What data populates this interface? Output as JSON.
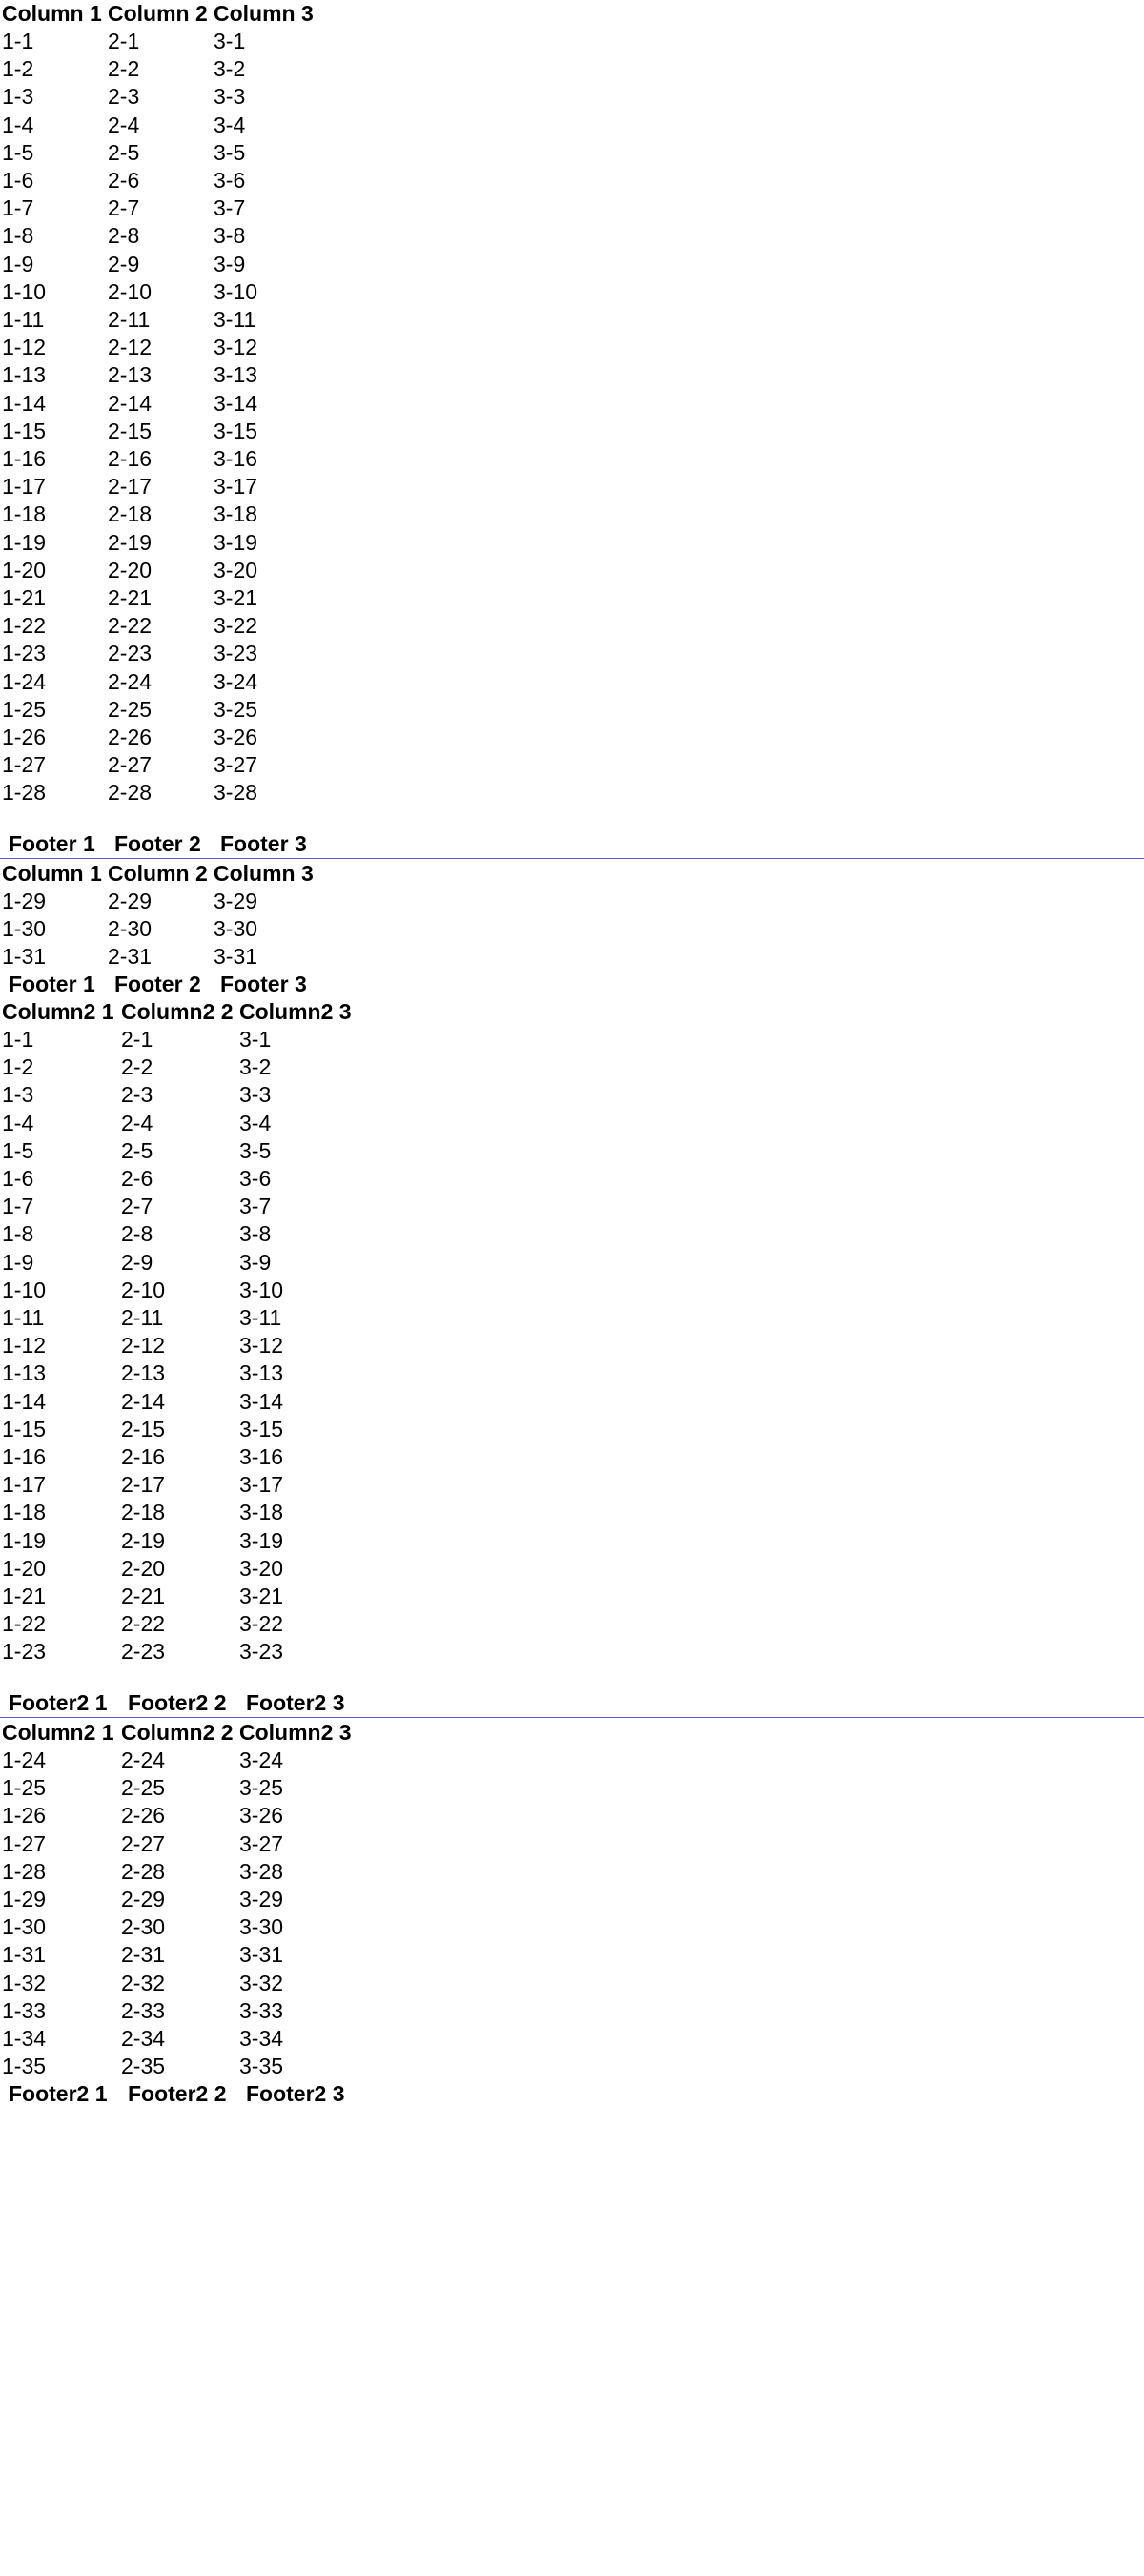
{
  "table1": {
    "headers": [
      "Column 1",
      "Column 2",
      "Column 3"
    ],
    "footers": [
      "Footer 1",
      "Footer 2",
      "Footer 3"
    ],
    "rows": [
      [
        "1-1",
        "2-1",
        "3-1"
      ],
      [
        "1-2",
        "2-2",
        "3-2"
      ],
      [
        "1-3",
        "2-3",
        "3-3"
      ],
      [
        "1-4",
        "2-4",
        "3-4"
      ],
      [
        "1-5",
        "2-5",
        "3-5"
      ],
      [
        "1-6",
        "2-6",
        "3-6"
      ],
      [
        "1-7",
        "2-7",
        "3-7"
      ],
      [
        "1-8",
        "2-8",
        "3-8"
      ],
      [
        "1-9",
        "2-9",
        "3-9"
      ],
      [
        "1-10",
        "2-10",
        "3-10"
      ],
      [
        "1-11",
        "2-11",
        "3-11"
      ],
      [
        "1-12",
        "2-12",
        "3-12"
      ],
      [
        "1-13",
        "2-13",
        "3-13"
      ],
      [
        "1-14",
        "2-14",
        "3-14"
      ],
      [
        "1-15",
        "2-15",
        "3-15"
      ],
      [
        "1-16",
        "2-16",
        "3-16"
      ],
      [
        "1-17",
        "2-17",
        "3-17"
      ],
      [
        "1-18",
        "2-18",
        "3-18"
      ],
      [
        "1-19",
        "2-19",
        "3-19"
      ],
      [
        "1-20",
        "2-20",
        "3-20"
      ],
      [
        "1-21",
        "2-21",
        "3-21"
      ],
      [
        "1-22",
        "2-22",
        "3-22"
      ],
      [
        "1-23",
        "2-23",
        "3-23"
      ],
      [
        "1-24",
        "2-24",
        "3-24"
      ],
      [
        "1-25",
        "2-25",
        "3-25"
      ],
      [
        "1-26",
        "2-26",
        "3-26"
      ],
      [
        "1-27",
        "2-27",
        "3-27"
      ],
      [
        "1-28",
        "2-28",
        "3-28"
      ],
      [
        "1-29",
        "2-29",
        "3-29"
      ],
      [
        "1-30",
        "2-30",
        "3-30"
      ],
      [
        "1-31",
        "2-31",
        "3-31"
      ]
    ]
  },
  "table2": {
    "headers": [
      "Column2 1",
      "Column2 2",
      "Column2 3"
    ],
    "footers": [
      "Footer2 1",
      "Footer2 2",
      "Footer2 3"
    ],
    "rows": [
      [
        "1-1",
        "2-1",
        "3-1"
      ],
      [
        "1-2",
        "2-2",
        "3-2"
      ],
      [
        "1-3",
        "2-3",
        "3-3"
      ],
      [
        "1-4",
        "2-4",
        "3-4"
      ],
      [
        "1-5",
        "2-5",
        "3-5"
      ],
      [
        "1-6",
        "2-6",
        "3-6"
      ],
      [
        "1-7",
        "2-7",
        "3-7"
      ],
      [
        "1-8",
        "2-8",
        "3-8"
      ],
      [
        "1-9",
        "2-9",
        "3-9"
      ],
      [
        "1-10",
        "2-10",
        "3-10"
      ],
      [
        "1-11",
        "2-11",
        "3-11"
      ],
      [
        "1-12",
        "2-12",
        "3-12"
      ],
      [
        "1-13",
        "2-13",
        "3-13"
      ],
      [
        "1-14",
        "2-14",
        "3-14"
      ],
      [
        "1-15",
        "2-15",
        "3-15"
      ],
      [
        "1-16",
        "2-16",
        "3-16"
      ],
      [
        "1-17",
        "2-17",
        "3-17"
      ],
      [
        "1-18",
        "2-18",
        "3-18"
      ],
      [
        "1-19",
        "2-19",
        "3-19"
      ],
      [
        "1-20",
        "2-20",
        "3-20"
      ],
      [
        "1-21",
        "2-21",
        "3-21"
      ],
      [
        "1-22",
        "2-22",
        "3-22"
      ],
      [
        "1-23",
        "2-23",
        "3-23"
      ],
      [
        "1-24",
        "2-24",
        "3-24"
      ],
      [
        "1-25",
        "2-25",
        "3-25"
      ],
      [
        "1-26",
        "2-26",
        "3-26"
      ],
      [
        "1-27",
        "2-27",
        "3-27"
      ],
      [
        "1-28",
        "2-28",
        "3-28"
      ],
      [
        "1-29",
        "2-29",
        "3-29"
      ],
      [
        "1-30",
        "2-30",
        "3-30"
      ],
      [
        "1-31",
        "2-31",
        "3-31"
      ],
      [
        "1-32",
        "2-32",
        "3-32"
      ],
      [
        "1-33",
        "2-33",
        "3-33"
      ],
      [
        "1-34",
        "2-34",
        "3-34"
      ],
      [
        "1-35",
        "2-35",
        "3-35"
      ]
    ]
  },
  "colors": {
    "separator": "#5b5bd6",
    "text": "#000000",
    "background": "#ffffff"
  }
}
